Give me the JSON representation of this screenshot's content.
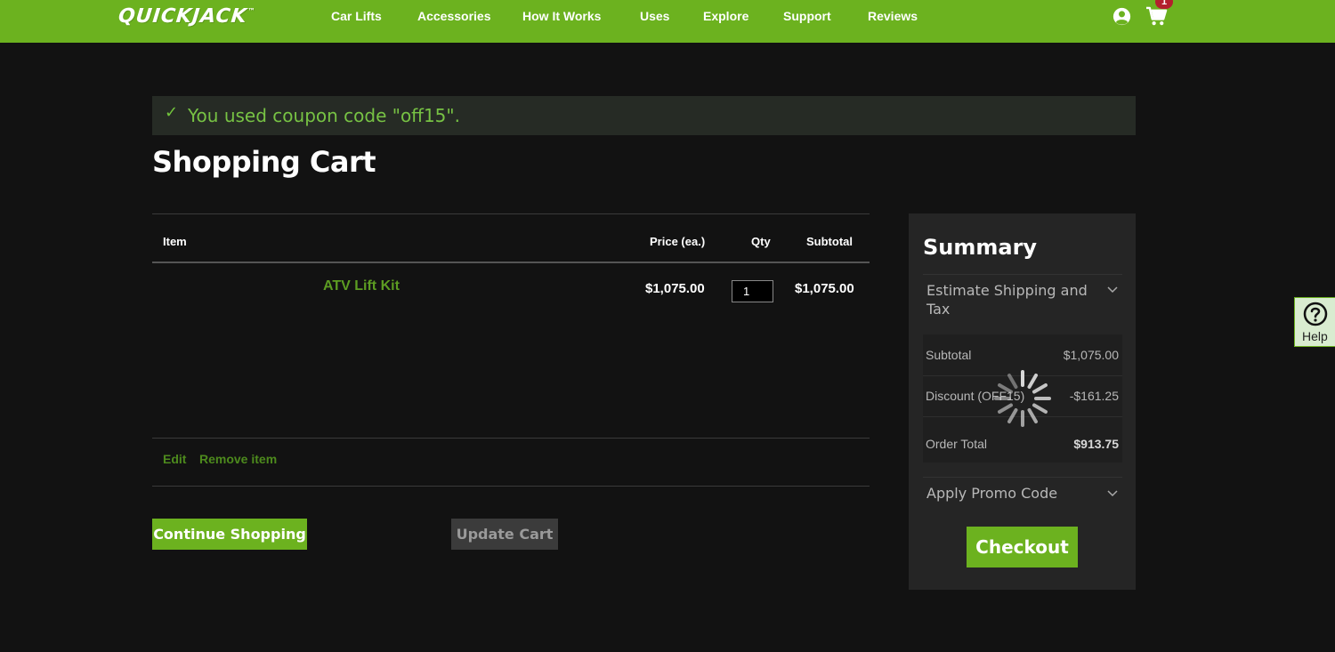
{
  "header": {
    "logo": "QUICKJACK",
    "logo_tm": "™",
    "nav": [
      "Car Lifts",
      "Accessories",
      "How It Works",
      "Uses",
      "Explore",
      "Support",
      "Reviews"
    ],
    "account_icon": "account-icon",
    "cart_icon": "cart-icon",
    "cart_count": "1",
    "brand_color": "#6cb21f"
  },
  "message": {
    "icon": "check-icon",
    "text": "You used coupon code \"off15\"."
  },
  "page_title": "Shopping Cart",
  "cart": {
    "columns": [
      "Item",
      "Price (ea.)",
      "Qty",
      "Subtotal"
    ],
    "items": [
      {
        "name": "ATV Lift Kit",
        "price": "$1,075.00",
        "qty": "1",
        "subtotal": "$1,075.00"
      }
    ],
    "actions": [
      "Edit",
      "Remove item"
    ]
  },
  "buttons": {
    "continue": "Continue Shopping",
    "update": "Update Cart",
    "checkout": "Checkout"
  },
  "summary": {
    "title": "Summary",
    "shipping_line1": "Estimate Shipping and",
    "shipping_line2": "Tax",
    "subtotal_label": "Subtotal",
    "subtotal_value": "$1,075.00",
    "discount_label": "Discount (OFF15)",
    "discount_value": "-$161.25",
    "total_label": "Order Total",
    "total_value": "$913.75",
    "promo": "Apply Promo Code"
  },
  "help": {
    "icon": "question-icon",
    "label": "Help"
  }
}
